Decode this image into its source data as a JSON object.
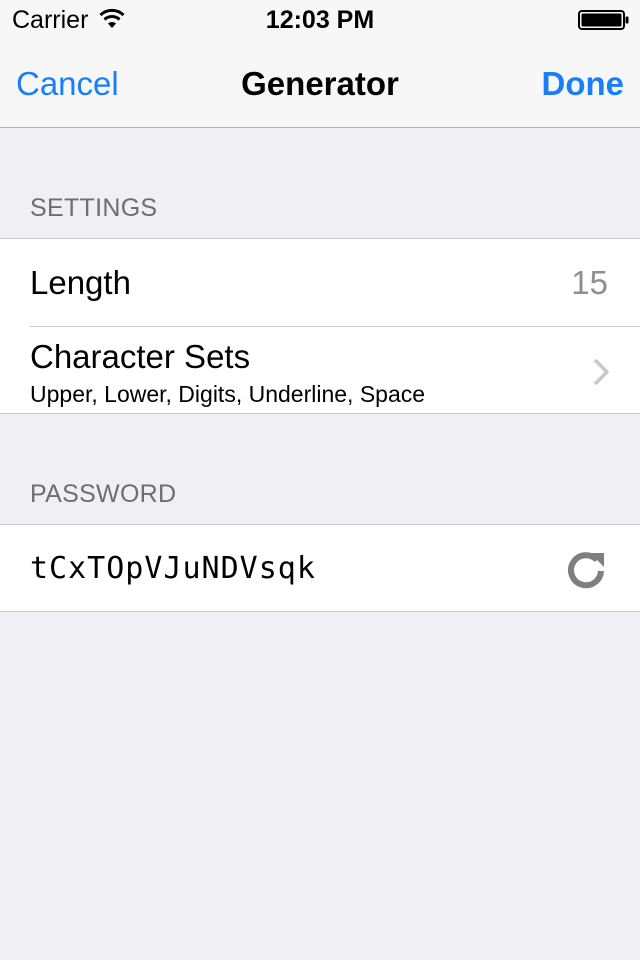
{
  "status_bar": {
    "carrier": "Carrier",
    "time": "12:03 PM",
    "wifi_icon": "wifi-icon",
    "battery_icon": "battery-icon"
  },
  "nav": {
    "cancel_label": "Cancel",
    "title": "Generator",
    "done_label": "Done",
    "accent_color": "#1a7ef6"
  },
  "settings": {
    "header": "SETTINGS",
    "length": {
      "label": "Length",
      "value": "15"
    },
    "character_sets": {
      "label": "Character Sets",
      "summary": "Upper, Lower, Digits, Underline, Space",
      "accessory_icon": "chevron-right-icon"
    }
  },
  "password": {
    "header": "PASSWORD",
    "value": "tCxTOpVJuNDVsqk",
    "refresh_icon": "refresh-icon"
  }
}
